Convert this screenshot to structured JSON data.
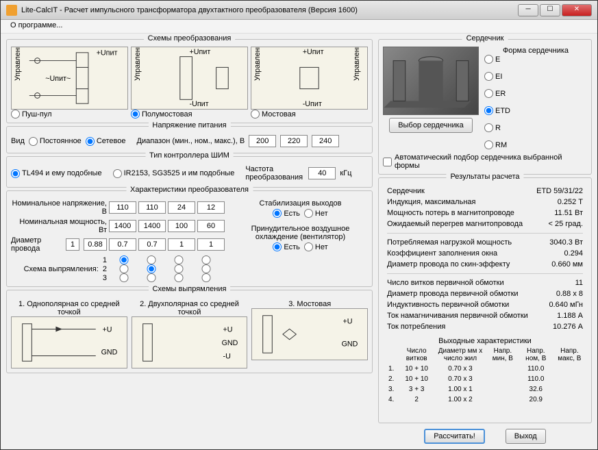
{
  "window": {
    "title": "Lite-CalcIT - Расчет импульсного трансформатора двухтактного преобразователя (Версия 1600)"
  },
  "menu": {
    "about": "О программе..."
  },
  "schemes": {
    "title": "Схемы преобразования",
    "upit": "+Uпит",
    "upr": "Управление",
    "opt1": "Пуш-пул",
    "opt2": "Полумостовая",
    "opt3": "Мостовая"
  },
  "psu": {
    "title": "Напряжение питания",
    "kind": "Вид",
    "const": "Постоянное",
    "ac": "Сетевое",
    "range": "Диапазон (мин., ном., макс.), В",
    "vmin": "200",
    "vnom": "220",
    "vmax": "240"
  },
  "pwm": {
    "title": "Тип контроллера ШИМ",
    "opt1": "TL494 и ему подобные",
    "opt2": "IR2153, SG3525 и им подобные",
    "freq_label": "Частота преобразования",
    "freq": "40",
    "unit": "кГц"
  },
  "conv": {
    "title": "Характеристики преобразователя",
    "nv": "Номинальное напряжение, В",
    "np": "Номинальная мощность, Вт",
    "wd": "Диаметр провода",
    "wd_pri": "1",
    "wd_pri_d": "0.88",
    "v": [
      "110",
      "110",
      "24",
      "12"
    ],
    "p": [
      "1400",
      "1400",
      "100",
      "60"
    ],
    "d": [
      "0.7",
      "0.7",
      "1",
      "1"
    ],
    "rect": "Схема выпрямления:",
    "stab": "Стабилизация выходов",
    "yes": "Есть",
    "no": "Нет",
    "cool": "Принудительное воздушное охлаждение (вентилятор)"
  },
  "rects": {
    "title": "Схемы выпрямления",
    "r1": "1. Однополярная со средней точкой",
    "r2": "2. Двухполярная со средней точкой",
    "r3": "3. Мостовая"
  },
  "core": {
    "title": "Сердечник",
    "shape_title": "Форма сердечника",
    "shapes": [
      "E",
      "EI",
      "ER",
      "ETD",
      "R",
      "RM"
    ],
    "select_btn": "Выбор сердечника",
    "auto": "Автоматический подбор сердечника выбранной формы"
  },
  "results": {
    "title": "Результаты расчета",
    "rows": [
      [
        "Сердечник",
        "ETD 59/31/22"
      ],
      [
        "Индукция, максимальная",
        "0.252 Т"
      ],
      [
        "Мощность потерь в магнитопроводе",
        "11.51 Вт"
      ],
      [
        "Ожидаемый перегрев магнитопровода",
        "< 25 град."
      ],
      [
        "",
        ""
      ],
      [
        "Потребляемая нагрузкой мощность",
        "3040.3 Вт"
      ],
      [
        "Коэффициент заполнения окна",
        "0.294"
      ],
      [
        "Диаметр провода по скин-эффекту",
        "0.660 мм"
      ],
      [
        "",
        ""
      ],
      [
        "Число витков первичной обмотки",
        "11"
      ],
      [
        "Диаметр провода первичной обмотки",
        "0.88 x 8"
      ],
      [
        "Индуктивность первичной обмотки",
        "0.640 мГн"
      ],
      [
        "Ток намагничивания первичной обмотки",
        "1.188 А"
      ],
      [
        "Ток потребления",
        "10.276 А"
      ]
    ],
    "out_title": "Выходные характеристики",
    "out_head": [
      "",
      "Число витков",
      "Диаметр мм x число жил",
      "Напр. мин, В",
      "Напр. ном, В",
      "Напр. макс, В"
    ],
    "out_rows": [
      [
        "1.",
        "10 + 10",
        "0.70 x 3",
        "",
        "110.0",
        ""
      ],
      [
        "2.",
        "10 + 10",
        "0.70 x 3",
        "",
        "110.0",
        ""
      ],
      [
        "3.",
        "3 + 3",
        "1.00 x 1",
        "",
        "32.6",
        ""
      ],
      [
        "4.",
        "2",
        "1.00 x 2",
        "",
        "20.9",
        ""
      ]
    ]
  },
  "buttons": {
    "calc": "Рассчитать!",
    "exit": "Выход"
  }
}
